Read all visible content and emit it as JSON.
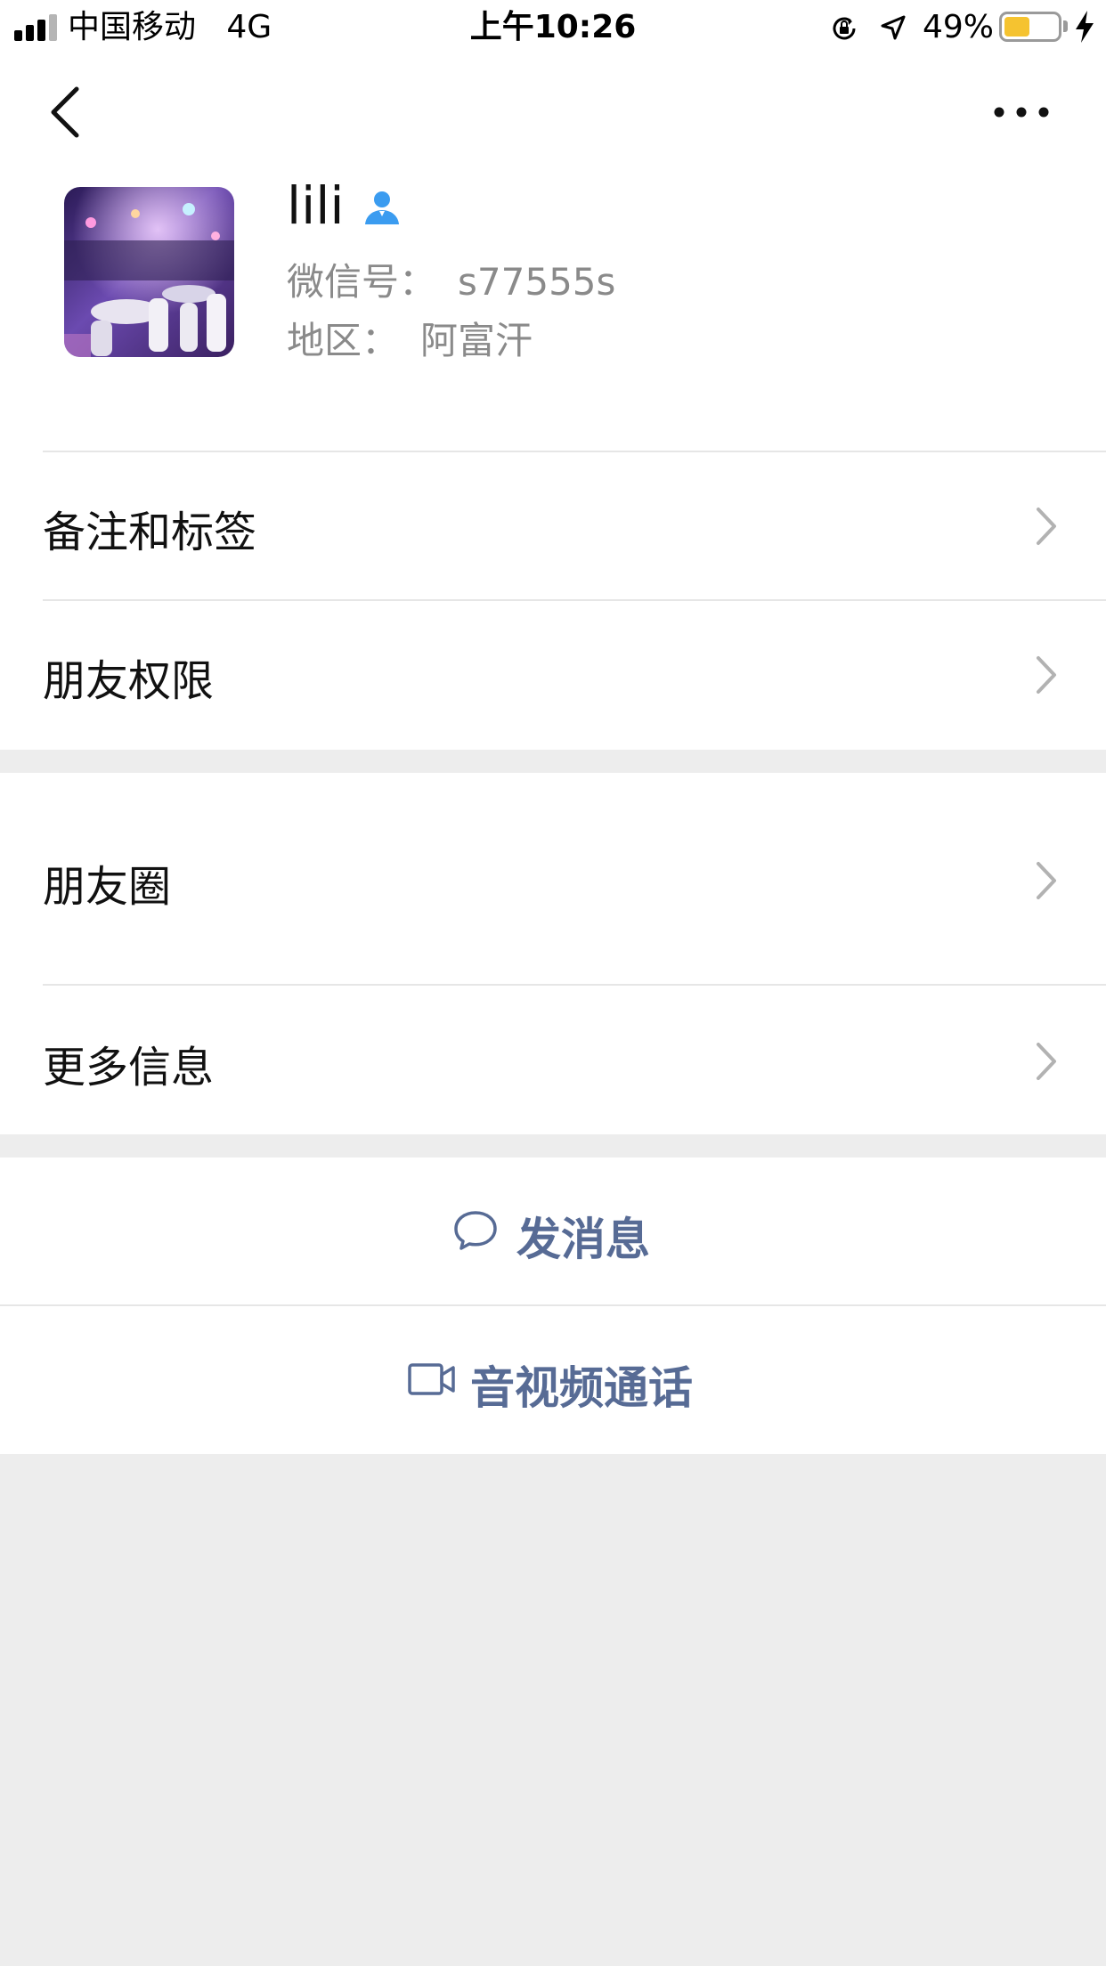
{
  "status_bar": {
    "carrier": "中国移动",
    "network": "4G",
    "time": "上午10:26",
    "battery_percent": "49%",
    "battery_level": 0.49,
    "battery_color": "#f5c330",
    "icons": [
      "signal-icon",
      "orientation-lock-icon",
      "location-icon",
      "battery-icon",
      "charging-icon"
    ]
  },
  "nav": {
    "back_icon": "chevron-left-icon",
    "more_icon": "more-dots-icon"
  },
  "profile": {
    "name": "lili",
    "wechat_id_label": "微信号：",
    "wechat_id": "s77555s",
    "region_label": "地区：",
    "region": "阿富汗"
  },
  "menu": {
    "notes_tags": "备注和标签",
    "friend_permissions": "朋友权限",
    "moments": "朋友圈",
    "more_info": "更多信息"
  },
  "actions": {
    "send_message": "发消息",
    "video_call": "音视频通话"
  },
  "colors": {
    "accent": "#576b95",
    "background": "#ededed",
    "person_icon": "#3b9cf0"
  }
}
